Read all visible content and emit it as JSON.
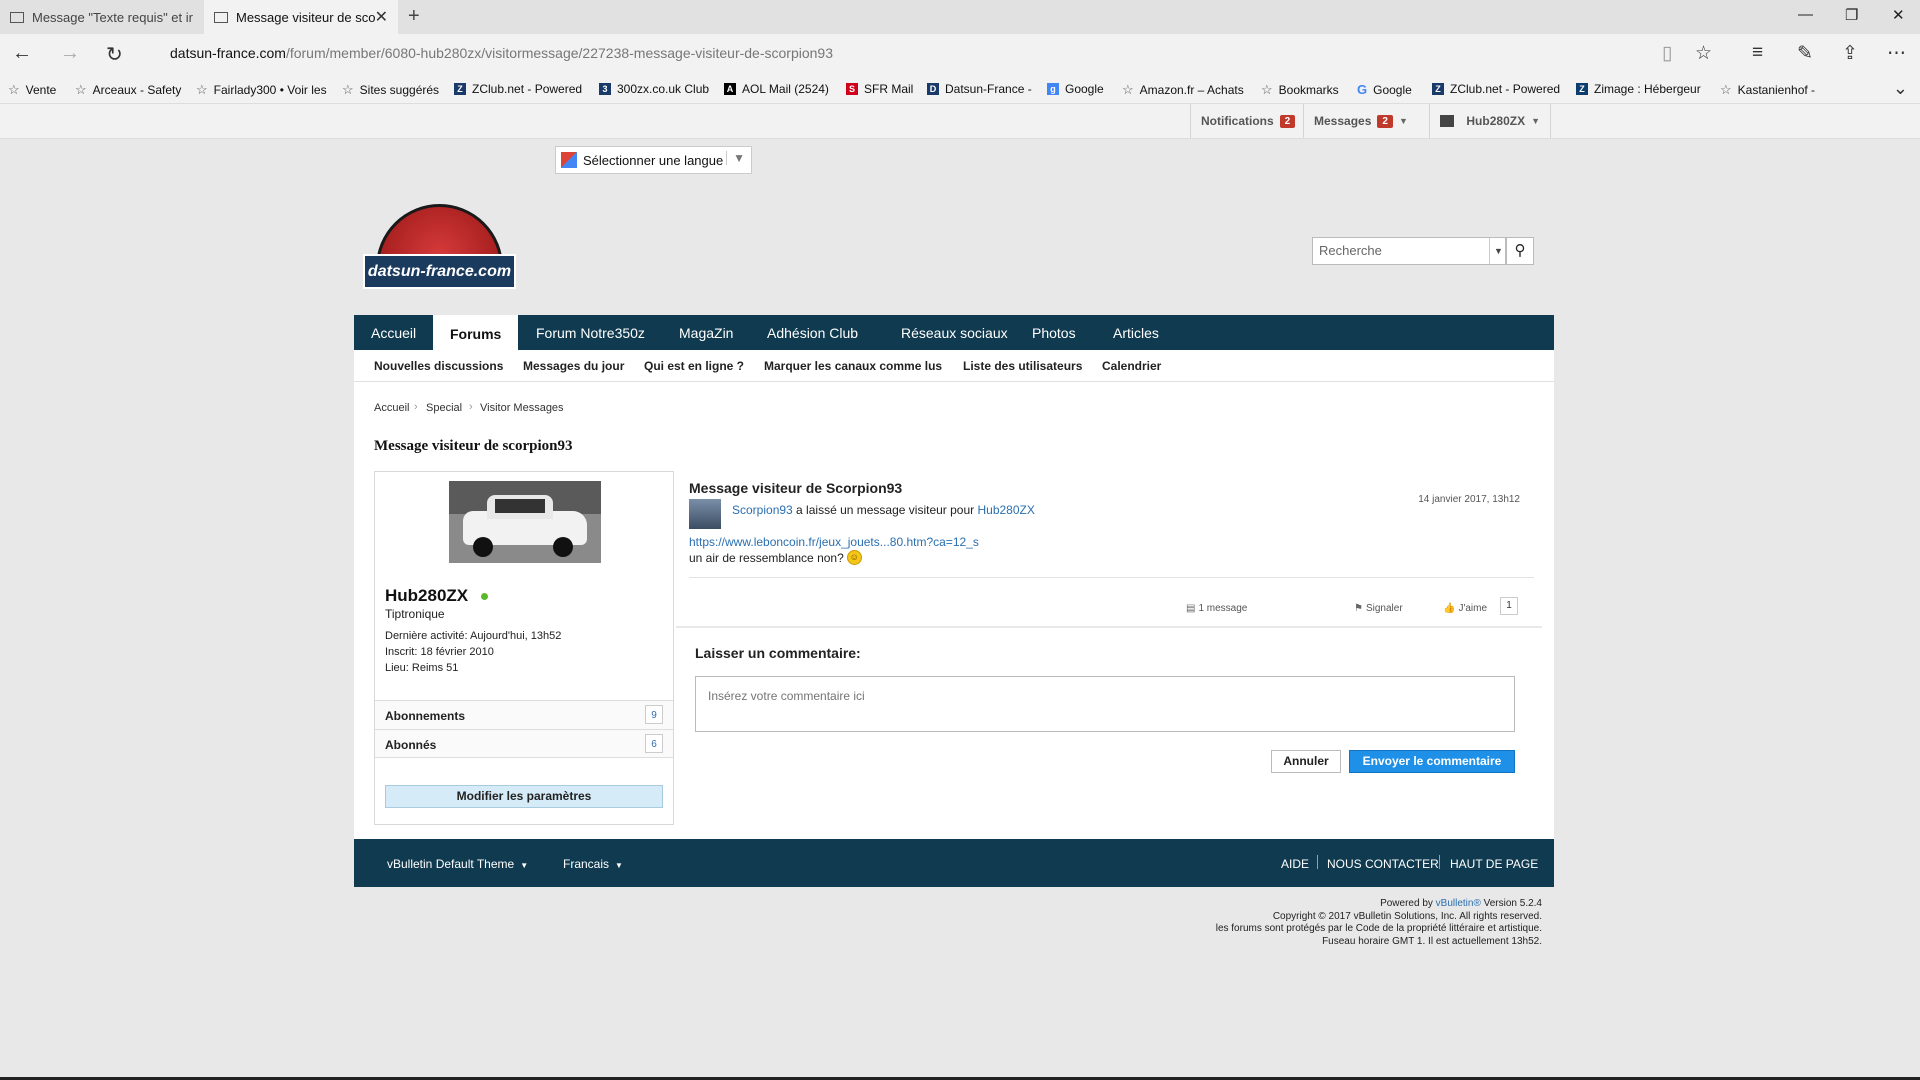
{
  "browser": {
    "tabs": [
      {
        "title": "Message \"Texte requis\" et ir"
      },
      {
        "title": "Message visiteur de sco",
        "close": "✕"
      }
    ],
    "new_tab": "+",
    "window_controls": {
      "minimize": "—",
      "restore": "❐",
      "close": "✕"
    },
    "url_host": "datsun-france.com",
    "url_path": "/forum/member/6080-hub280zx/visitormessage/227238-message-visiteur-de-scorpion93",
    "favorites": [
      {
        "label": "Vente",
        "icon": "star-icon"
      },
      {
        "label": "Arceaux - Safety",
        "icon": "star-icon"
      },
      {
        "label": "Fairlady300 • Voir les",
        "icon": "star-icon"
      },
      {
        "label": "Sites suggérés",
        "icon": "star-icon"
      },
      {
        "label": "ZClub.net - Powered",
        "icon": "zclub-icon"
      },
      {
        "label": "300zx.co.uk Club",
        "icon": "site-icon"
      },
      {
        "label": "AOL Mail (2524)",
        "icon": "aol-icon"
      },
      {
        "label": "SFR Mail",
        "icon": "sfr-icon"
      },
      {
        "label": "Datsun-France -",
        "icon": "site-icon"
      },
      {
        "label": "Google",
        "icon": "google-icon"
      },
      {
        "label": "Amazon.fr – Achats",
        "icon": "star-icon"
      },
      {
        "label": "Bookmarks",
        "icon": "star-icon"
      },
      {
        "label": "Google",
        "icon": "google-icon"
      },
      {
        "label": "ZClub.net - Powered",
        "icon": "zclub-icon"
      },
      {
        "label": "Zimage : Hébergeur",
        "icon": "zimage-icon"
      },
      {
        "label": "Kastanienhof -",
        "icon": "star-icon"
      }
    ]
  },
  "topbar": {
    "notifications_label": "Notifications",
    "notifications_count": "2",
    "messages_label": "Messages",
    "messages_count": "2",
    "user": "Hub280ZX"
  },
  "language": {
    "label": "Sélectionner une langue"
  },
  "logo_text": "datsun-france.com",
  "search": {
    "placeholder": "Recherche"
  },
  "main_nav": [
    "Accueil",
    "Forums",
    "Forum Notre350z",
    "MagaZin",
    "Adhésion Club",
    "Réseaux sociaux",
    "Photos",
    "Articles"
  ],
  "sub_nav": [
    "Nouvelles discussions",
    "Messages du jour",
    "Qui est en ligne ?",
    "Marquer les canaux comme lus",
    "Liste des utilisateurs",
    "Calendrier"
  ],
  "breadcrumb": [
    "Accueil",
    "Special",
    "Visitor Messages"
  ],
  "page_title": "Message visiteur de scorpion93",
  "profile": {
    "username": "Hub280ZX",
    "rank": "Tiptronique",
    "last_activity": "Dernière activité: Aujourd'hui, 13h52",
    "joined": "Inscrit: 18 février 2010",
    "location": "Lieu: Reims 51",
    "subscriptions_label": "Abonnements",
    "subscriptions_count": "9",
    "followers_label": "Abonnés",
    "followers_count": "6",
    "settings_button": "Modifier les paramètres"
  },
  "message": {
    "title": "Message visiteur de Scorpion93",
    "date": "14 janvier 2017, 13h12",
    "author": "Scorpion93",
    "action_text": " a laissé un message visiteur pour ",
    "recipient": "Hub280ZX",
    "link": "https://www.leboncoin.fr/jeux_jouets...80.htm?ca=12_s",
    "text": "un air de ressemblance non?",
    "actions": {
      "messages": "1 message",
      "report": "Signaler",
      "like": "J'aime",
      "like_count": "1"
    }
  },
  "comment": {
    "label": "Laisser un commentaire:",
    "placeholder": "Insérez votre commentaire ici",
    "cancel": "Annuler",
    "submit": "Envoyer le commentaire"
  },
  "footer": {
    "theme": "vBulletin Default Theme",
    "language": "Francais",
    "links": [
      "AIDE",
      "NOUS CONTACTER",
      "HAUT DE PAGE"
    ]
  },
  "copyright": {
    "powered_prefix": "Powered by ",
    "powered_brand": "vBulletin®",
    "powered_suffix": " Version 5.2.4",
    "line2": "Copyright © 2017 vBulletin Solutions, Inc. All rights reserved.",
    "line3": "les forums sont protégés par le Code de la propriété littéraire et artistique.",
    "line4": "Fuseau horaire GMT 1. Il est actuellement 13h52."
  },
  "colors": {
    "nav_bg": "#0f3a4f",
    "link": "#2a6fb0",
    "submit_button": "#1e90e8",
    "badge": "#c0392b",
    "online": "#5cb82a"
  }
}
